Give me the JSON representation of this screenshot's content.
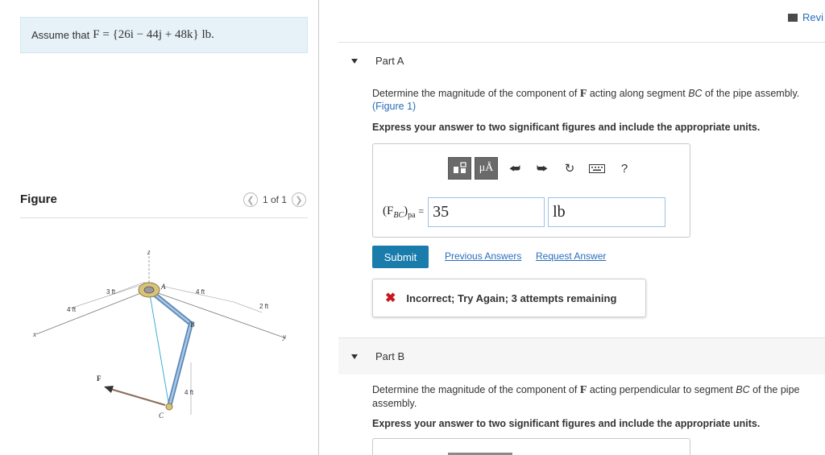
{
  "review": {
    "label": "Revi"
  },
  "given": {
    "prefix": "Assume that",
    "equation": "F = {26i − 44j + 48k} lb."
  },
  "figure_panel": {
    "title": "Figure",
    "pager": "1 of 1",
    "labels": {
      "z": "z",
      "x": "x",
      "y": "y",
      "A": "A",
      "B": "B",
      "C": "C",
      "F": "F",
      "d_3ft": "3 ft",
      "d_4ft_top": "4 ft",
      "d_4ft_left": "4 ft",
      "d_2ft": "2 ft",
      "d_4ft_vert": "4 ft"
    }
  },
  "part_a": {
    "title": "Part A",
    "question_pre": "Determine the magnitude of the component of",
    "question_bold": "F",
    "question_mid": "acting along segment",
    "question_seg": "BC",
    "question_post": "of the pipe assembly.",
    "figure_link": "(Figure 1)",
    "instruction": "Express your answer to two significant figures and include the appropriate units.",
    "toolbar": {
      "mu_label": "μÅ",
      "help_label": "?"
    },
    "answer_label_main": "(F",
    "answer_label_sub_seg": "BC",
    "answer_label_close": ")",
    "answer_label_sub": "pa",
    "answer_label_eq": "=",
    "value": "35",
    "unit": "lb",
    "submit_label": "Submit",
    "previous_answers": "Previous Answers",
    "request_answer": "Request Answer",
    "feedback": "Incorrect; Try Again; 3 attempts remaining"
  },
  "part_b": {
    "title": "Part B",
    "question_pre": "Determine the magnitude of the component of",
    "question_bold": "F",
    "question_mid": "acting perpendicular to segment",
    "question_seg": "BC",
    "question_post": "of the pipe assembly.",
    "instruction": "Express your answer to two significant figures and include the appropriate units."
  },
  "colors": {
    "accent": "#1a7cab",
    "link": "#2a6dbb",
    "error": "#c8161d",
    "given_bg": "#e6f2f8"
  }
}
